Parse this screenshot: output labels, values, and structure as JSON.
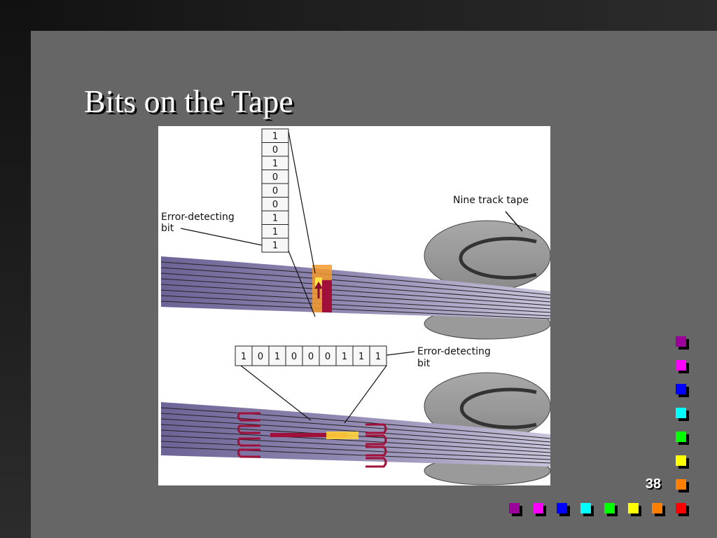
{
  "slide": {
    "title": "Bits on the Tape",
    "page_number": "38"
  },
  "figure": {
    "vertical_bits": [
      "1",
      "0",
      "1",
      "0",
      "0",
      "0",
      "1",
      "1",
      "1"
    ],
    "horizontal_bits": [
      "1",
      "0",
      "1",
      "0",
      "0",
      "0",
      "1",
      "1",
      "1"
    ],
    "label_nine_track": "Nine track tape",
    "label_error_top_line1": "Error-detecting",
    "label_error_top_line2": "bit",
    "label_error_bottom_line1": "Error-detecting",
    "label_error_bottom_line2": "bit"
  },
  "decor": {
    "vertical_squares": [
      "#9b009b",
      "#ff00ff",
      "#0000ff",
      "#00ffff",
      "#00ff00",
      "#ffff00",
      "#ff8000"
    ],
    "horizontal_squares": [
      "#9b009b",
      "#ff00ff",
      "#0000ff",
      "#00ffff",
      "#00ff00",
      "#ffff00",
      "#ff8000",
      "#ff0000"
    ]
  }
}
